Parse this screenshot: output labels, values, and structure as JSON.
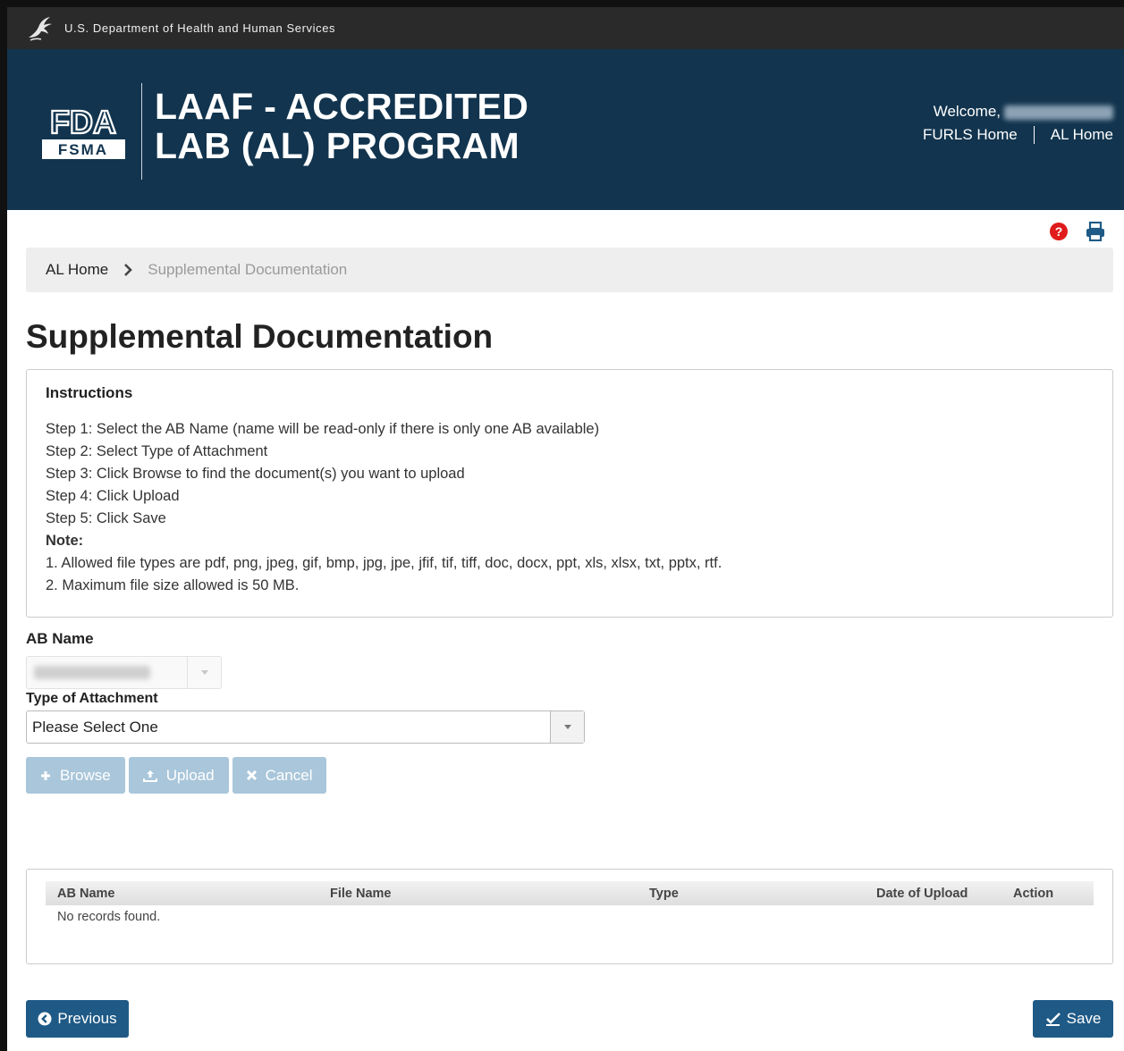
{
  "hhs_bar": {
    "text": "U.S. Department of Health and Human Services"
  },
  "header": {
    "title_line1": "LAAF - ACCREDITED",
    "title_line2": "LAB (AL) PROGRAM",
    "logo_top": "FDA",
    "logo_bottom": "FSMA",
    "welcome_label": "Welcome,",
    "links": [
      "FURLS Home",
      "AL Home"
    ]
  },
  "toolbar": {
    "icons": [
      "help-icon",
      "print-icon"
    ],
    "help_color": "#e01b1b",
    "print_color": "#1f5a86"
  },
  "breadcrumb": {
    "home": "AL Home",
    "current": "Supplemental Documentation"
  },
  "page": {
    "title": "Supplemental Documentation"
  },
  "instructions": {
    "title": "Instructions",
    "steps": [
      "Step 1: Select the AB Name (name will be read-only if there is only one AB available)",
      "Step 2: Select Type of Attachment",
      "Step 3: Click Browse to find the document(s) you want to upload",
      "Step 4: Click Upload",
      "Step 5: Click Save"
    ],
    "note_label": "Note:",
    "notes": [
      "1. Allowed file types are pdf, png, jpeg, gif, bmp, jpg, jpe, jfif, tif, tiff, doc, docx, ppt, xls, xlsx, txt, pptx, rtf.",
      "2. Maximum file size allowed is 50 MB."
    ]
  },
  "form": {
    "ab_name_label": "AB Name",
    "type_label": "Type of Attachment",
    "type_value": "Please Select One"
  },
  "upload_buttons": {
    "browse": "Browse",
    "upload": "Upload",
    "cancel": "Cancel"
  },
  "results": {
    "columns": [
      "AB Name",
      "File Name",
      "Type",
      "Date of Upload",
      "Action"
    ],
    "empty": "No records found."
  },
  "footer": {
    "previous": "Previous",
    "save": "Save"
  },
  "colors": {
    "banner": "#12344e",
    "primary_button": "#1f5a86",
    "disabled_button": "#a9c6da"
  }
}
